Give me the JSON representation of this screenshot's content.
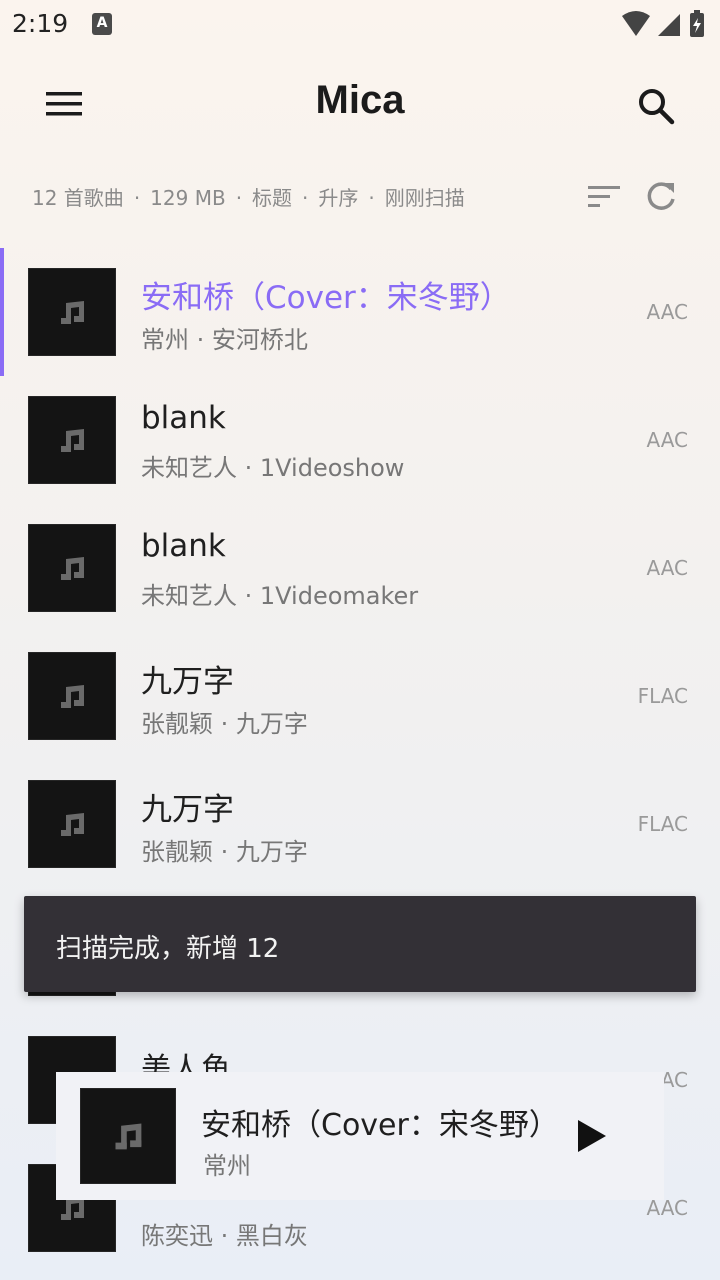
{
  "status_bar": {
    "time": "2:19",
    "notification_label": "A"
  },
  "app_bar": {
    "title": "Mica"
  },
  "info_bar": {
    "song_count": "12 首歌曲",
    "size": "129 MB",
    "sort_field": "标题",
    "sort_order": "升序",
    "scan_time": "刚刚扫描",
    "separator": "·"
  },
  "songs": [
    {
      "title": "安和桥（Cover：宋冬野）",
      "subtitle": "常州 · 安河桥北",
      "format": "AAC"
    },
    {
      "title": "blank",
      "subtitle": "未知艺人 · 1Videoshow",
      "format": "AAC"
    },
    {
      "title": "blank",
      "subtitle": "未知艺人 · 1Videomaker",
      "format": "AAC"
    },
    {
      "title": "九万字",
      "subtitle": "张靓颖 · 九万字",
      "format": "FLAC"
    },
    {
      "title": "九万字",
      "subtitle": "张靓颖 · 九万字",
      "format": "FLAC"
    },
    {
      "title": "美人鱼",
      "subtitle": "",
      "format": "AAC"
    },
    {
      "title": "",
      "subtitle": "陈奕迅 · 黑白灰",
      "format": "AAC"
    }
  ],
  "snackbar": {
    "text": "扫描完成，新增 12"
  },
  "mini_player": {
    "title": "安和桥（Cover：宋冬野）",
    "artist": "常州"
  },
  "colors": {
    "accent": "#8a6cf5",
    "snackbar_bg": "#333036"
  },
  "icons": [
    "menu-icon",
    "search-icon",
    "sort-icon",
    "refresh-icon",
    "music-note-icon",
    "play-icon",
    "wifi-icon",
    "signal-icon",
    "battery-icon"
  ]
}
